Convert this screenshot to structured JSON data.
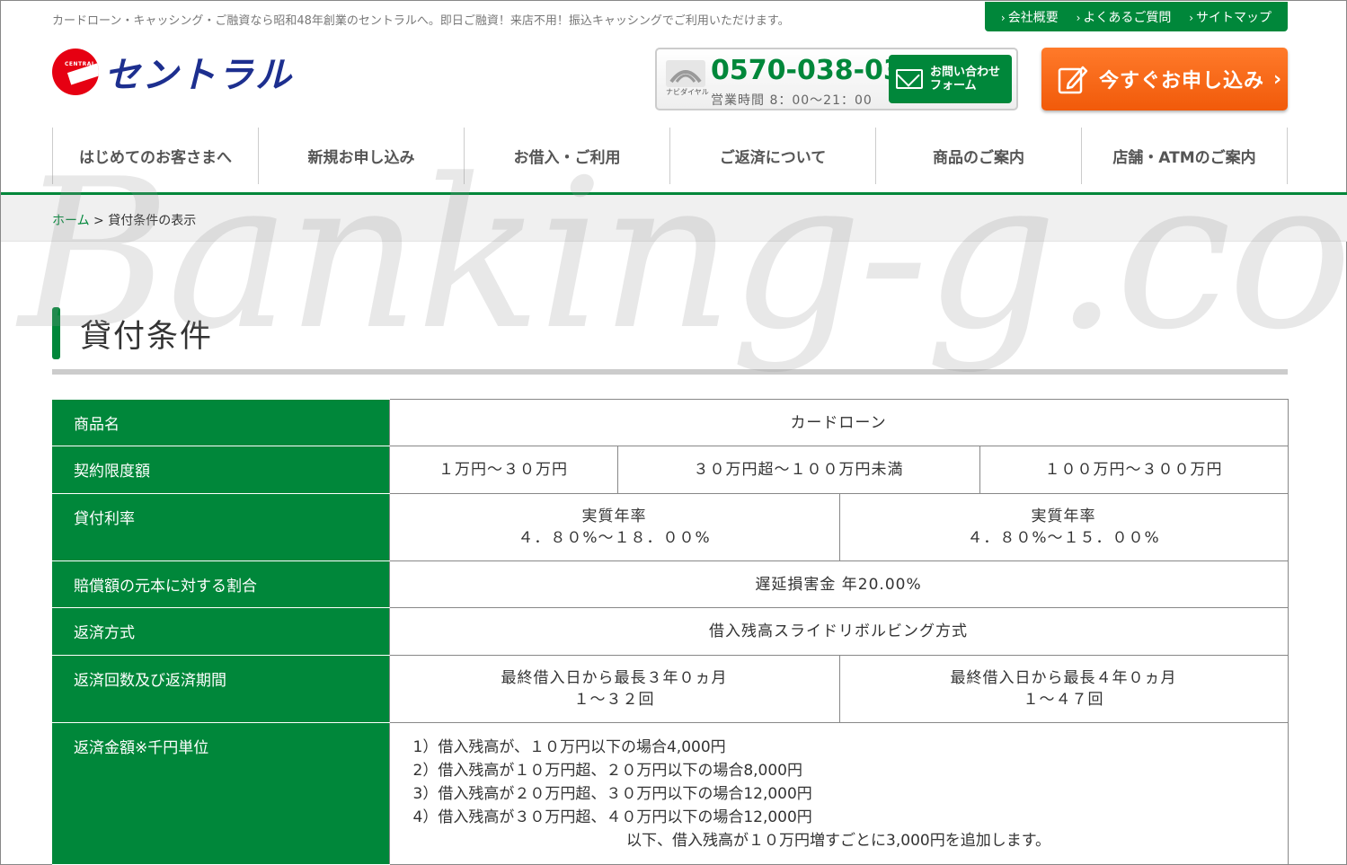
{
  "header": {
    "tagline": "カードローン・キャッシング・ご融資なら昭和48年創業のセントラルへ。即日ご融資！来店不用！振込キャッシングでご利用いただけます。",
    "toplinks": [
      {
        "label": "会社概要"
      },
      {
        "label": "よくあるご質問"
      },
      {
        "label": "サイトマップ"
      }
    ],
    "logo_small": "CENTRAL",
    "logo_text": "セントラル",
    "navi_label": "ナビダイヤル",
    "phone": "0570-038-038",
    "hours": "営業時間 8：00〜21：00",
    "contact_line1": "お問い合わせ",
    "contact_line2": "フォーム",
    "apply_label": "今すぐお申し込み",
    "apply_arrow": "›"
  },
  "colors": {
    "brand_green": "#00873a",
    "apply_orange": "#f15a0a",
    "logo_red": "#e60012",
    "logo_blue": "#1d2f8f"
  },
  "nav": [
    "はじめてのお客さまへ",
    "新規お申し込み",
    "お借入・ご利用",
    "ご返済について",
    "商品のご案内",
    "店舗・ATMのご案内"
  ],
  "breadcrumb": {
    "home": "ホーム",
    "sep": " > ",
    "current": "貸付条件の表示"
  },
  "page_title": "貸付条件",
  "watermark": "Banking-g.com",
  "table": {
    "product_label": "商品名",
    "product_value": "カードローン",
    "limit_label": "契約限度額",
    "limits": [
      "１万円〜３０万円",
      "３０万円超〜１００万円未満",
      "１００万円〜３００万円"
    ],
    "rate_label": "貸付利率",
    "rates": [
      {
        "line1": "実質年率",
        "line2": "４．８０%〜１８．００%"
      },
      {
        "line1": "実質年率",
        "line2": "４．８０%〜１５．００%"
      }
    ],
    "damages_label": "賠償額の元本に対する割合",
    "damages_value": "遅延損害金 年20.00%",
    "method_label": "返済方式",
    "method_value": "借入残高スライドリボルビング方式",
    "period_label": "返済回数及び返済期間",
    "periods": [
      {
        "line1": "最終借入日から最長３年０ヵ月",
        "line2": "１〜３２回"
      },
      {
        "line1": "最終借入日から最長４年０ヵ月",
        "line2": "１〜４７回"
      }
    ],
    "amount_label": "返済金額※千円単位",
    "amount_lines": [
      "1）借入残高が、１０万円以下の場合4,000円",
      "2）借入残高が１０万円超、２０万円以下の場合8,000円",
      "3）借入残高が２０万円超、３０万円以下の場合12,000円",
      "4）借入残高が３０万円超、４０万円以下の場合12,000円"
    ],
    "amount_note": "以下、借入残高が１０万円増すごとに3,000円を追加します。"
  }
}
